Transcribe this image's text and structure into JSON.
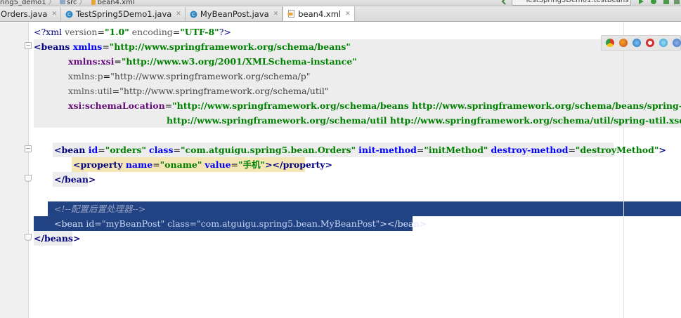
{
  "breadcrumb": {
    "project": "ring5_demo1",
    "folder": "src",
    "file": "bean4.xml"
  },
  "toolbar": {
    "run_config": "TestSpring5Demo1.testBeans"
  },
  "tabs": [
    {
      "label": "Orders.java",
      "icon": "java-class-icon",
      "color": "#e48b2a",
      "active": false
    },
    {
      "label": "TestSpring5Demo1.java",
      "icon": "java-class-icon",
      "color": "#2e88c6",
      "active": false
    },
    {
      "label": "MyBeanPost.java",
      "icon": "java-class-icon",
      "color": "#2e88c6",
      "active": false
    },
    {
      "label": "bean4.xml",
      "icon": "xml-file-icon",
      "color": "#e9a43a",
      "active": true
    }
  ],
  "code": {
    "l1": {
      "open": "<?xml ",
      "a1": "version",
      "eq1": "=",
      "v1": "\"1.0\"",
      "sp": " ",
      "a2": "encoding",
      "eq2": "=",
      "v2": "\"UTF-8\"",
      "close": "?>"
    },
    "l2": {
      "tag": "<beans ",
      "attr": "xmlns",
      "eq": "=",
      "val": "\"http://www.springframework.org/schema/beans\""
    },
    "l3": {
      "attr": "xmlns:xsi",
      "eq": "=",
      "val": "\"http://www.w3.org/2001/XMLSchema-instance\""
    },
    "l4": {
      "attr": "xmlns:p",
      "eq": "=",
      "val": "\"http://www.springframework.org/schema/p\""
    },
    "l5": {
      "attr": "xmlns:util",
      "eq": "=",
      "val": "\"http://www.springframework.org/schema/util\""
    },
    "l6": {
      "attr": "xsi:schemaLocation",
      "eq": "=",
      "val": "\"http://www.springframework.org/schema/beans http://www.springframework.org/schema/beans/spring-beans.xsd"
    },
    "l7": {
      "val": "http://www.springframework.org/schema/util http://www.springframework.org/schema/util/spring-util.xsd\"",
      "close": ">"
    },
    "l9": {
      "tag": "<bean ",
      "a1": "id",
      "v1": "\"orders\"",
      "a2": "class",
      "v2": "\"com.atguigu.spring5.bean.Orders\"",
      "a3": "init-method",
      "v3": "\"initMethod\"",
      "a4": "destroy-method",
      "v4": "\"destroyMethod\"",
      "close": ">"
    },
    "l10": {
      "tag": "<property ",
      "a1": "name",
      "v1": "\"oname\"",
      "a2": "value",
      "v2": "\"手机\"",
      "close": "></property>"
    },
    "l11": {
      "tag": "</bean>"
    },
    "l13": {
      "comment": "<!--配置后置处理器-->"
    },
    "l14": {
      "tag": "<bean ",
      "a1": "id",
      "v1": "\"myBeanPost\"",
      "a2": "class",
      "v2": "\"com.atguigu.spring5.bean.MyBeanPost\"",
      "close": "></bean>"
    },
    "l15": {
      "tag": "</beans>"
    }
  },
  "browsers": [
    "chrome-icon",
    "firefox-icon",
    "safari-icon",
    "opera-icon",
    "ie-icon",
    "edge-icon"
  ]
}
